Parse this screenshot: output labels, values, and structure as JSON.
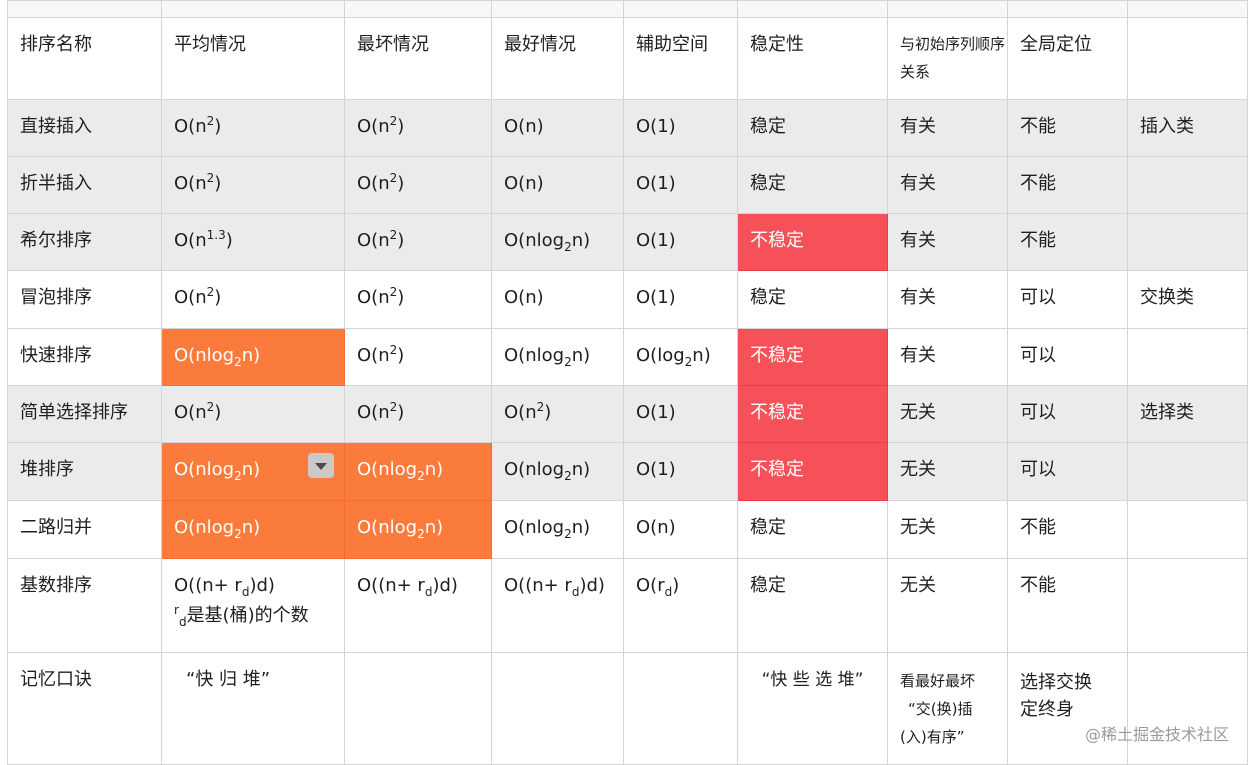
{
  "headers": [
    "排序名称",
    "平均情况",
    "最坏情况",
    "最好情况",
    "辅助空间",
    "稳定性",
    "与初始序列顺序关系",
    "全局定位",
    ""
  ],
  "rows": [
    {
      "name": "直接插入",
      "avg": "O(n²)",
      "worst": "O(n²)",
      "best": "O(n)",
      "space": "O(1)",
      "stable": "稳定",
      "relation": "有关",
      "global": "不能",
      "category": "插入类"
    },
    {
      "name": "折半插入",
      "avg": "O(n²)",
      "worst": "O(n²)",
      "best": "O(n)",
      "space": "O(1)",
      "stable": "稳定",
      "relation": "有关",
      "global": "不能",
      "category": ""
    },
    {
      "name": "希尔排序",
      "avg": "O(n^1.3)",
      "worst": "O(n²)",
      "best": "O(nlog₂n)",
      "space": "O(1)",
      "stable": "不稳定",
      "relation": "有关",
      "global": "不能",
      "category": ""
    },
    {
      "name": "冒泡排序",
      "avg": "O(n²)",
      "worst": "O(n²)",
      "best": "O(n)",
      "space": "O(1)",
      "stable": "稳定",
      "relation": "有关",
      "global": "可以",
      "category": "交换类"
    },
    {
      "name": "快速排序",
      "avg": "O(nlog₂n)",
      "worst": "O(n²)",
      "best": "O(nlog₂n)",
      "space": "O(log₂n)",
      "stable": "不稳定",
      "relation": "有关",
      "global": "可以",
      "category": ""
    },
    {
      "name": "简单选择排序",
      "avg": "O(n²)",
      "worst": "O(n²)",
      "best": "O(n²)",
      "space": "O(1)",
      "stable": "不稳定",
      "relation": "无关",
      "global": "可以",
      "category": "选择类"
    },
    {
      "name": "堆排序",
      "avg": "O(nlog₂n)",
      "worst": "O(nlog₂n)",
      "best": "O(nlog₂n)",
      "space": "O(1)",
      "stable": "不稳定",
      "relation": "无关",
      "global": "可以",
      "category": ""
    },
    {
      "name": "二路归并",
      "avg": "O(nlog₂n)",
      "worst": "O(nlog₂n)",
      "best": "O(nlog₂n)",
      "space": "O(n)",
      "stable": "稳定",
      "relation": "无关",
      "global": "不能",
      "category": ""
    },
    {
      "name": "基数排序",
      "avg": "O((n+ r_d)d)",
      "avg_note": "r_d是基(桶)的个数",
      "worst": "O((n+ r_d)d)",
      "best": "O((n+ r_d)d)",
      "space": "O(r_d)",
      "stable": "稳定",
      "relation": "无关",
      "global": "不能",
      "category": ""
    }
  ],
  "mnemonic": {
    "label": "记忆口诀",
    "unstable_time": "“快 归 堆”",
    "unstable": "“快 些 选 堆”",
    "relation_line1": "看最好最坏",
    "relation_line2": "“交(换)插",
    "relation_line3": "(入)有序”",
    "global_line1": "选择交换",
    "global_line2": "定终身"
  },
  "parts": {
    "O_open": "O(",
    "n": "n",
    "close": ")",
    "sq": "2",
    "e13": "1.3",
    "nlog": "nlog",
    "log": "log",
    "two": "2",
    "one": "O(1)",
    "On": "O(n)",
    "Ordo": "O((n+ r",
    "d": "d",
    "dclose": ")d)",
    "Or": "O(r",
    "r": "r",
    "note_tail": "是基(桶)的个数"
  },
  "watermark": "@稀土掘金技术社区",
  "colors": {
    "orange": "#fb7b3c",
    "red": "#f65158",
    "grey_row": "#ebebeb"
  }
}
